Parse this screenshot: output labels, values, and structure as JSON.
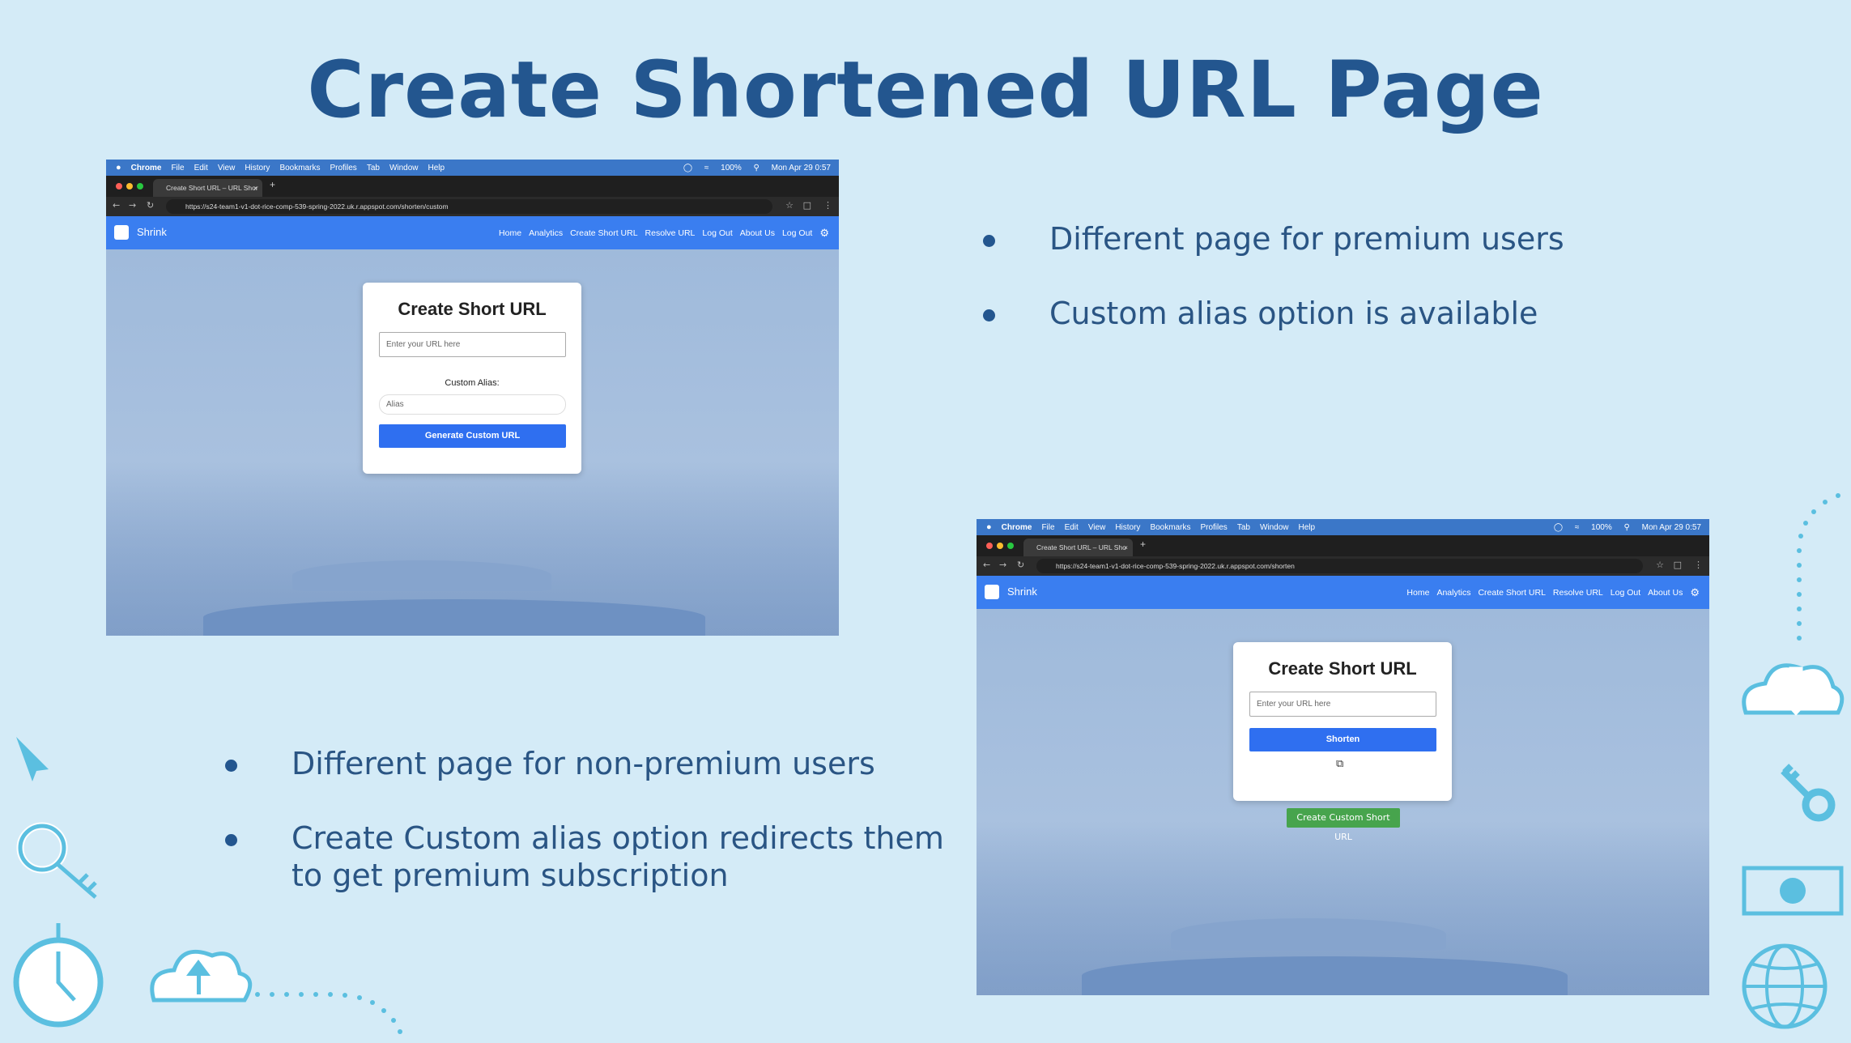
{
  "slide": {
    "title": "Create Shortened URL Page",
    "bullets_top": [
      "Different page for premium users",
      "Custom alias option is available"
    ],
    "bullets_bottom": [
      "Different page for non-premium users",
      "Create Custom alias option redirects them to get premium subscription"
    ]
  },
  "shot_premium": {
    "mac_menu": [
      "Chrome",
      "File",
      "Edit",
      "View",
      "History",
      "Bookmarks",
      "Profiles",
      "Tab",
      "Window",
      "Help"
    ],
    "mac_clock": "Mon Apr 29 0:57",
    "battery": "100%",
    "tab_title": "Create Short URL – URL Shor",
    "url": "https://s24-team1-v1-dot-rice-comp-539-spring-2022.uk.r.appspot.com/shorten/custom",
    "brand": "Shrink",
    "nav": [
      "Home",
      "Analytics",
      "Create Short URL",
      "Resolve URL",
      "Log Out",
      "About Us",
      "Log Out"
    ],
    "card_title": "Create Short URL",
    "url_placeholder": "Enter your URL here",
    "alias_label": "Custom Alias:",
    "alias_placeholder": "Alias",
    "button": "Generate Custom URL"
  },
  "shot_standard": {
    "mac_menu": [
      "Chrome",
      "File",
      "Edit",
      "View",
      "History",
      "Bookmarks",
      "Profiles",
      "Tab",
      "Window",
      "Help"
    ],
    "mac_clock": "Mon Apr 29 0:57",
    "battery": "100%",
    "tab_title": "Create Short URL – URL Sho",
    "url": "https://s24-team1-v1-dot-rice-comp-539-spring-2022.uk.r.appspot.com/shorten",
    "brand": "Shrink",
    "nav": [
      "Home",
      "Analytics",
      "Create Short URL",
      "Resolve URL",
      "Log Out",
      "About Us"
    ],
    "card_title": "Create Short URL",
    "url_placeholder": "Enter your URL here",
    "button": "Shorten",
    "custom_button": "Create Custom Short URL"
  },
  "colors": {
    "background": "#d4ebf7",
    "title": "#23568f",
    "appbar": "#3a7ef0",
    "button": "#2f6ff0",
    "green_button": "#47a44d",
    "deco": "#5bbfe0"
  },
  "icons": [
    "apple-icon",
    "shield-icon",
    "wifi-icon",
    "search-icon",
    "link-icon",
    "gear-icon",
    "copy-icon",
    "cursor-icon",
    "magnifier-key-icon",
    "clock-icon",
    "cloud-upload-icon",
    "cloud-download-icon",
    "key-icon",
    "banknote-icon",
    "globe-icon"
  ]
}
